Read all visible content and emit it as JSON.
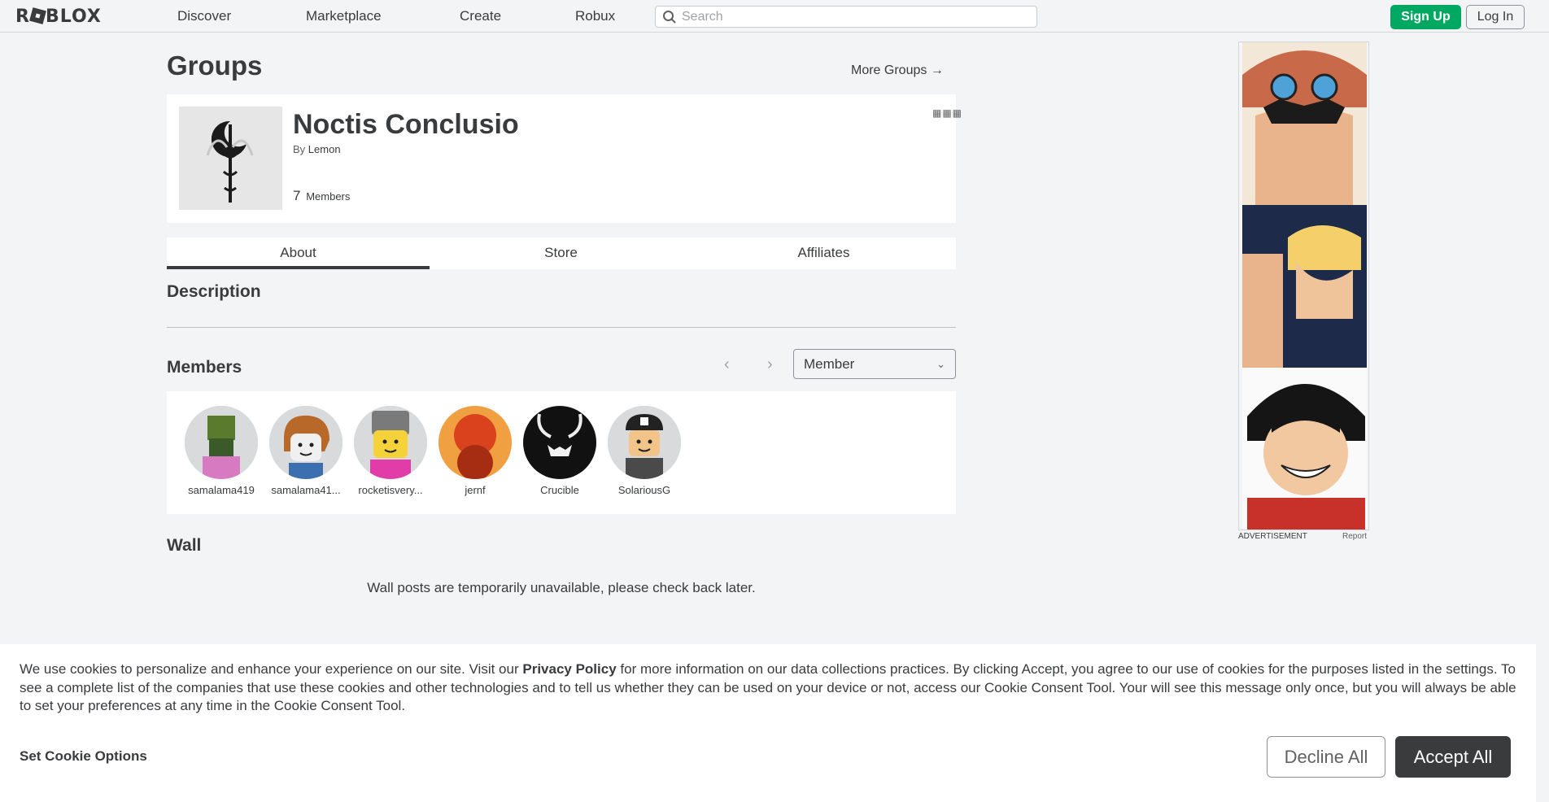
{
  "nav": {
    "logo": "ROBLOX",
    "links": [
      "Discover",
      "Marketplace",
      "Create",
      "Robux"
    ],
    "search_placeholder": "Search",
    "signup": "Sign Up",
    "login": "Log In"
  },
  "page": {
    "title": "Groups",
    "more_groups": "More Groups →"
  },
  "group": {
    "name": "Noctis Conclusio",
    "by_label": "By",
    "owner": "Lemon",
    "member_count": "7",
    "members_label": "Members",
    "menu_icon": "more-dots-icon"
  },
  "tabs": [
    "About",
    "Store",
    "Affiliates"
  ],
  "description_title": "Description",
  "members": {
    "title": "Members",
    "role_selected": "Member",
    "list": [
      {
        "name": "samalama419",
        "color": "#6b8e3a"
      },
      {
        "name": "samalama41...",
        "color": "#c47a2c"
      },
      {
        "name": "rocketisvery...",
        "color": "#f5d23a"
      },
      {
        "name": "jernf",
        "color": "#d9421c"
      },
      {
        "name": "Crucible",
        "color": "#111111"
      },
      {
        "name": "SolariousG",
        "color": "#3a3a3a"
      }
    ]
  },
  "wall": {
    "title": "Wall",
    "message": "Wall posts are temporarily unavailable, please check back later."
  },
  "ad": {
    "label": "ADVERTISEMENT",
    "report": "Report"
  },
  "cookie": {
    "text_before": "We use cookies to personalize and enhance your experience on our site. Visit our ",
    "privacy_policy": "Privacy Policy",
    "text_after": " for more information on our data collections practices. By clicking Accept, you agree to our use of cookies for the purposes listed in the settings. To see a complete list of the companies that use these cookies and other technologies and to tell us whether they can be used on your device or not, access our Cookie Consent Tool. Your will see this message only once, but you will always be able to set your preferences at any time in the Cookie Consent Tool.",
    "options": "Set Cookie Options",
    "decline": "Decline All",
    "accept": "Accept All"
  }
}
